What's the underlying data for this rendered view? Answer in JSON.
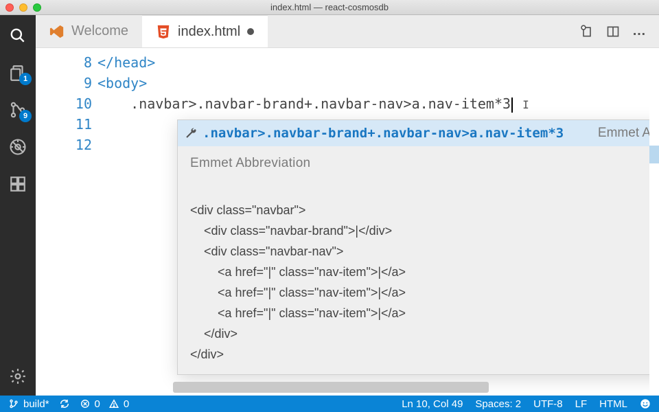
{
  "window": {
    "title": "index.html — react-cosmosdb"
  },
  "activity": {
    "explorer_badge": "1",
    "scm_badge": "9"
  },
  "tabs": {
    "welcome": "Welcome",
    "file": "index.html"
  },
  "actions": {
    "more": "…"
  },
  "code": {
    "lines": [
      {
        "n": "8",
        "text": "</head>"
      },
      {
        "n": "9",
        "text": "<body>"
      },
      {
        "n": "10",
        "text": ".navbar>.navbar-brand+.navbar-nav>a.nav-item*3"
      },
      {
        "n": "11",
        "text": ""
      },
      {
        "n": "12",
        "text": ""
      }
    ]
  },
  "suggest": {
    "match": ".navbar>.navbar-brand+.navbar-nav>a.nav-item*3",
    "hint": "Emmet A…",
    "heading": "Emmet Abbreviation",
    "expansion": [
      "<div class=\"navbar\">",
      "    <div class=\"navbar-brand\">|</div>",
      "    <div class=\"navbar-nav\">",
      "        <a href=\"|\" class=\"nav-item\">|</a>",
      "        <a href=\"|\" class=\"nav-item\">|</a>",
      "        <a href=\"|\" class=\"nav-item\">|</a>",
      "    </div>",
      "</div>"
    ]
  },
  "status": {
    "branch": "build*",
    "errors": "0",
    "warnings": "0",
    "cursor": "Ln 10, Col 49",
    "indent": "Spaces: 2",
    "encoding": "UTF-8",
    "eol": "LF",
    "lang": "HTML"
  }
}
